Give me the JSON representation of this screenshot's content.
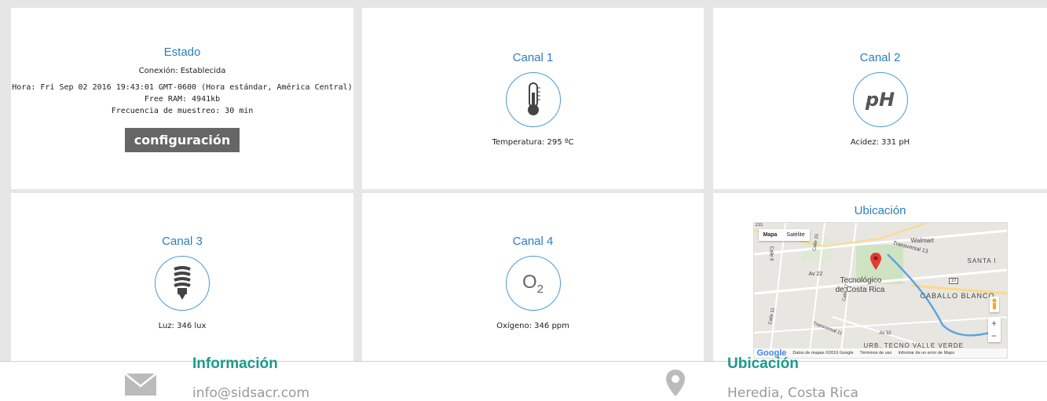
{
  "estado": {
    "title": "Estado",
    "conexion": "Conexión: Establecida",
    "hora": "Hora: Fri Sep 02 2016 19:43:01 GMT-0600 (Hora estándar, América Central)",
    "ram": "Free RAM: 4941kb",
    "frecuencia": "Frecuencia de muestreo: 30 min",
    "config_label": "configuración"
  },
  "canal1": {
    "title": "Canal 1",
    "icon": "thermometer-icon",
    "reading": "Temperatura: 295 ºC"
  },
  "canal2": {
    "title": "Canal 2",
    "icon": "ph-icon",
    "icon_text": "pH",
    "reading": "Acidez: 331 pH"
  },
  "canal3": {
    "title": "Canal 3",
    "icon": "light-bulb-icon",
    "reading": "Luz: 346 lux"
  },
  "canal4": {
    "title": "Canal 4",
    "icon": "oxygen-icon",
    "icon_text": "O",
    "icon_sub": "2",
    "reading": "Oxígeno: 346 ppm"
  },
  "ubicacion": {
    "title": "Ubicación",
    "map": {
      "tab_map": "Mapa",
      "tab_sat": "Satélite",
      "labels": {
        "walmart": "Walmart",
        "tec1": "Tecnológico",
        "tec2": "de Costa Rica",
        "santa": "SANTA I",
        "caballo": "CABALLO BLANCO",
        "urb": "URB. TECNO VALLE VERDE",
        "av22": "Av 22",
        "av32": "Av 32",
        "transversal13": "Transversal 13",
        "transversal11": "Transversal 11",
        "calle9": "Calle 9",
        "calle17": "Calle 17",
        "calle15": "Calle 15",
        "calle11": "Calle 11",
        "ruta10": "10",
        "ruta231": "231"
      },
      "zoom_in": "+",
      "zoom_out": "−",
      "google": "Google",
      "datos": "Datos de mapas ©2016 Google",
      "terminos": "Términos de uso",
      "error": "Informar de un error de Maps"
    }
  },
  "footer": {
    "info_title": "Información",
    "email": "info@sidsacr.com",
    "ubic_title": "Ubicación",
    "place": "Heredia, Costa Rica"
  },
  "colors": {
    "title_blue": "#2d7dbf",
    "footer_teal": "#1a9b8a",
    "button_gray": "#666666"
  }
}
